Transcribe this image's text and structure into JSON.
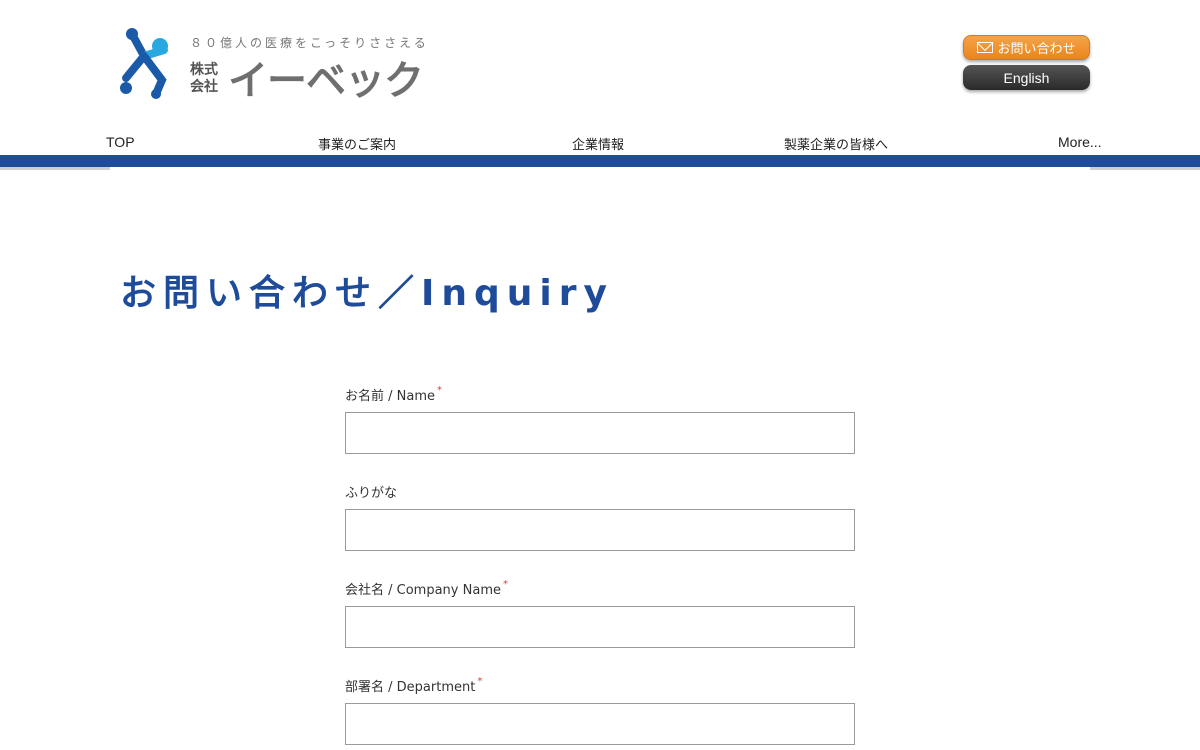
{
  "header": {
    "tagline": "８０億人の医療をこっそりささえる",
    "company_prefix": "株式 会社",
    "company_name": "イーベック",
    "contact_button": "お問い合わせ",
    "english_button": "English",
    "colors": {
      "brand_blue": "#1e4b9a",
      "contact_orange": "#e8861c",
      "logo_light_blue": "#29a8e0"
    }
  },
  "nav": {
    "items": [
      "TOP",
      "事業のご案内",
      "企業情報",
      "製薬企業の皆様へ",
      "More..."
    ]
  },
  "page": {
    "title": "お問い合わせ／Inquiry"
  },
  "form": {
    "fields": [
      {
        "label": "お名前 / Name",
        "required": true,
        "value": ""
      },
      {
        "label": "ふりがな",
        "required": false,
        "value": ""
      },
      {
        "label": "会社名 / Company Name",
        "required": true,
        "value": ""
      },
      {
        "label": "部署名 / Department",
        "required": true,
        "value": ""
      }
    ],
    "required_mark": "*"
  }
}
